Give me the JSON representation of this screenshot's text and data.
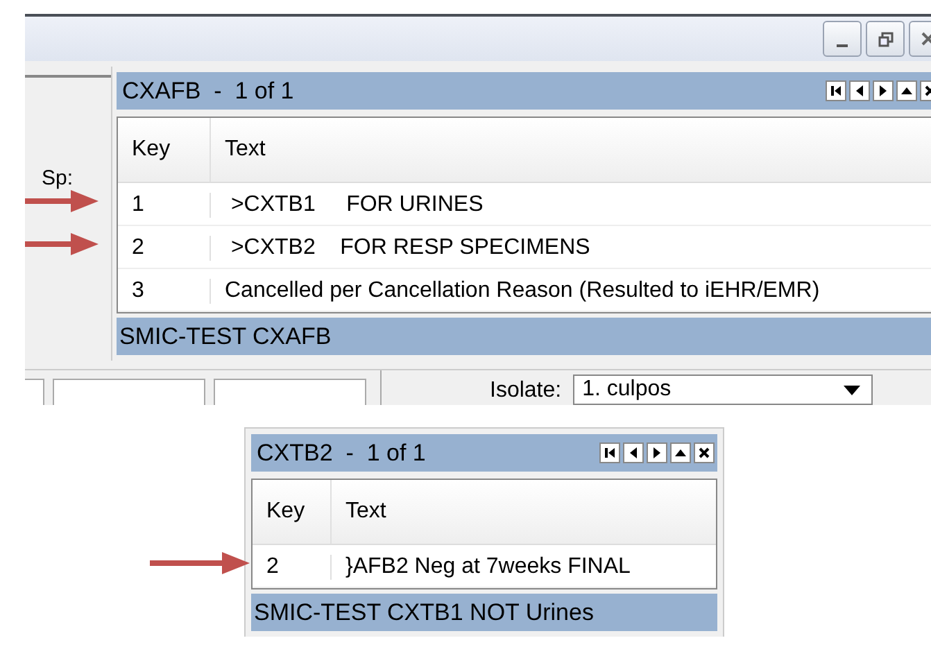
{
  "form": {
    "sp_label": "Sp:",
    "isolate_label": "Isolate:",
    "isolate_value": "1. culpos"
  },
  "popups": [
    {
      "title": "CXAFB  -  1 of 1",
      "columns": [
        "Key",
        "Text"
      ],
      "footer": "SMIC-TEST CXAFB",
      "rows": [
        {
          "key": "1",
          "text": " >CXTB1     FOR URINES",
          "arrow": true
        },
        {
          "key": "2",
          "text": " >CXTB2    FOR RESP SPECIMENS",
          "arrow": true
        },
        {
          "key": "3",
          "text": "Cancelled per Cancellation Reason (Resulted to iEHR/EMR)",
          "arrow": false
        }
      ]
    },
    {
      "title": "CXTB2  -  1 of 1",
      "columns": [
        "Key",
        "Text"
      ],
      "footer": "SMIC-TEST CXTB1 NOT Urines",
      "rows": [
        {
          "key": "2",
          "text": "}AFB2 Neg at 7weeks FINAL",
          "arrow": true
        }
      ]
    }
  ]
}
